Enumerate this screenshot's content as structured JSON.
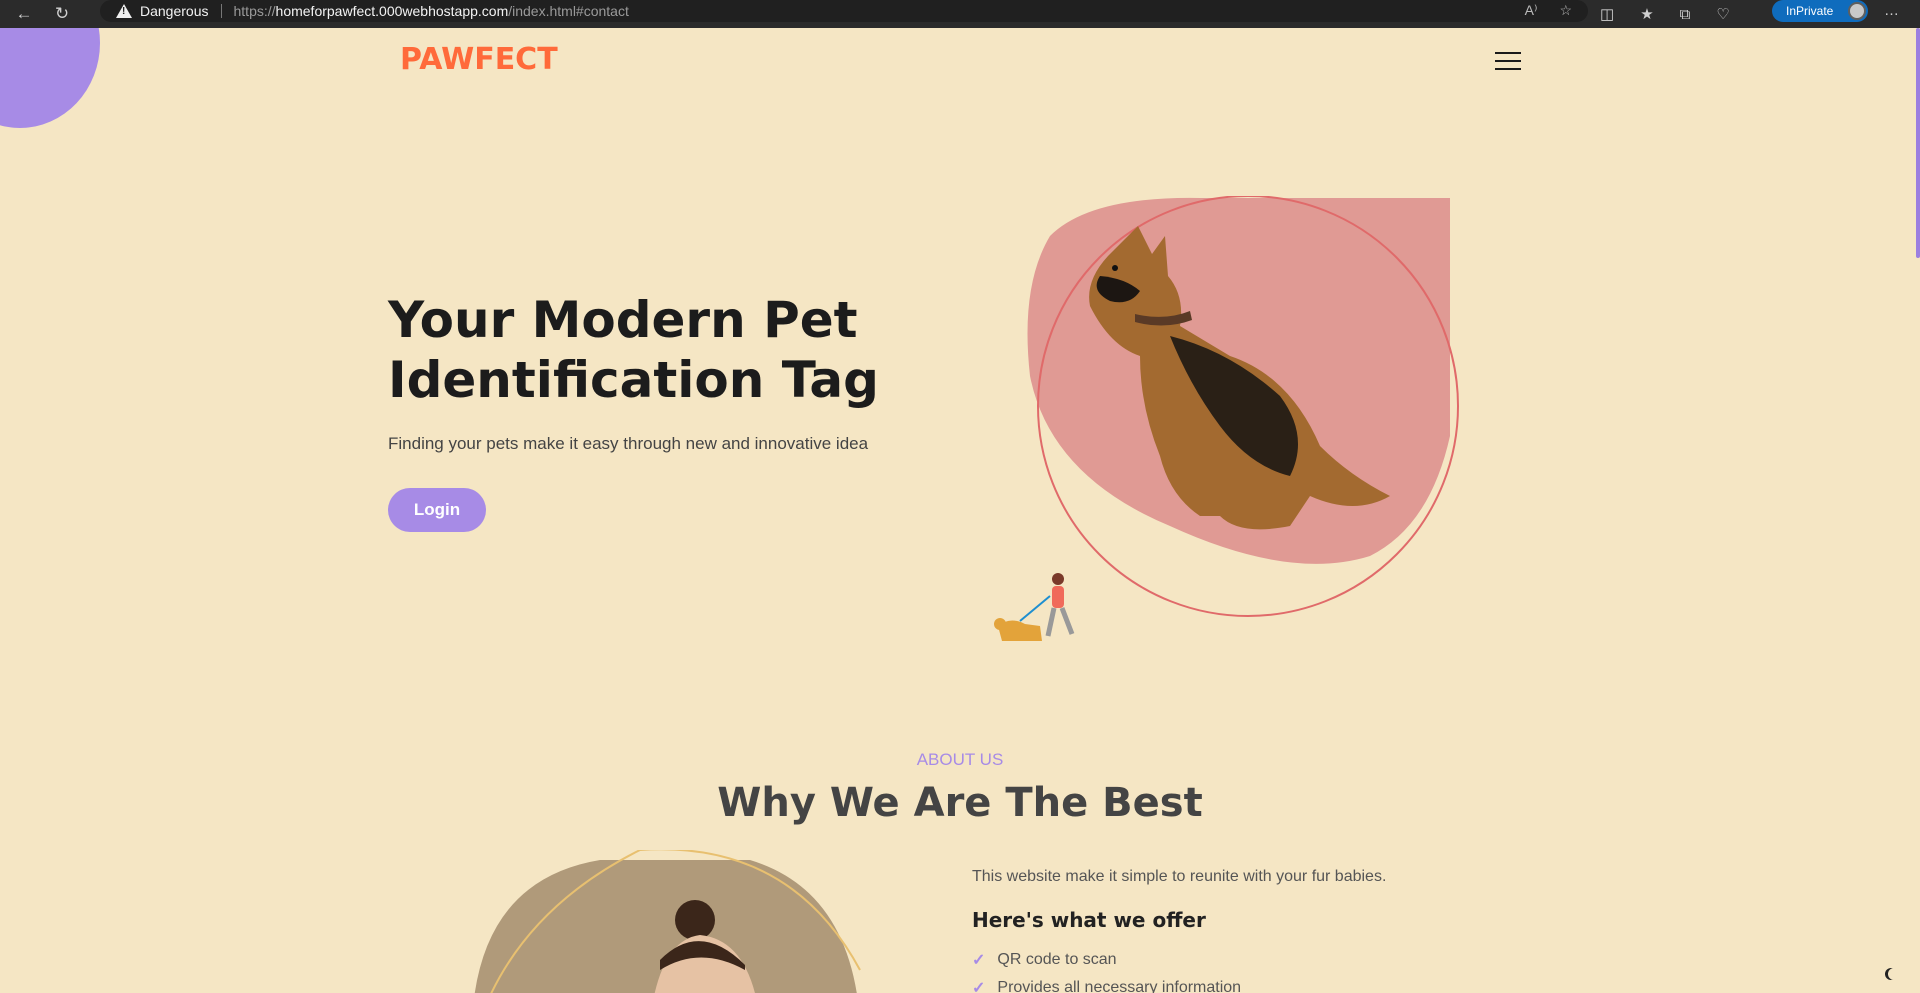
{
  "browser": {
    "security_label": "Dangerous",
    "url_prefix": "https://",
    "url_host": "homeforpawfect.000webhostapp.com",
    "url_path": "/index.html#contact",
    "inprivate_label": "InPrivate"
  },
  "site": {
    "logo_text": "PAWFECT"
  },
  "hero": {
    "title": "Your Modern Pet Identification Tag",
    "subtitle": "Finding your pets make it easy through new and innovative idea",
    "login_label": "Login"
  },
  "about": {
    "label": "ABOUT US",
    "title": "Why We Are The Best",
    "intro": "This website make it simple to reunite with your fur babies.",
    "offer_title": "Here's what we offer",
    "offers": [
      "QR code to scan",
      "Provides all necessary information"
    ]
  },
  "colors": {
    "background": "#f5e6c4",
    "accent": "#a78be6",
    "logo": "#ff6a3a",
    "blob": "#e09a94"
  }
}
